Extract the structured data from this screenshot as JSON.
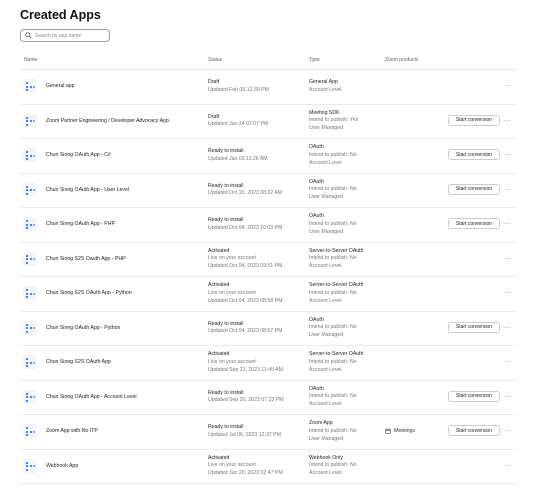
{
  "page": {
    "title": "Created Apps"
  },
  "search": {
    "placeholder": "Search by app name"
  },
  "table": {
    "headers": {
      "name": "Name",
      "status": "Status",
      "type": "Type",
      "products": "Zoom products"
    },
    "convert_label": "Start conversion",
    "more_label": "···",
    "rows": [
      {
        "name": "General app",
        "status": [
          "Draft",
          "Updated Feb 05 12:39 PM"
        ],
        "type": [
          "General App",
          "Account Level"
        ],
        "product": "",
        "convert": false
      },
      {
        "name": "Zoom Partner Engineering / Developer Advocacy App",
        "status": [
          "Draft",
          "Updated Jan 24 02:07 PM"
        ],
        "type": [
          "Meeting SDK",
          "Intend to publish: Yes",
          "User Managed"
        ],
        "product": "",
        "convert": true
      },
      {
        "name": "Chun Siong OAuth App - C#",
        "status": [
          "Ready to install",
          "Updated Jan 03 11:26 AM"
        ],
        "type": [
          "OAuth",
          "Intend to publish: No",
          "Account Level"
        ],
        "product": "",
        "convert": true
      },
      {
        "name": "Chun Siong OAuth App - User Level",
        "status": [
          "Ready to install",
          "Updated Oct 10, 2023 08:32 AM"
        ],
        "type": [
          "OAuth",
          "Intend to publish: No",
          "User Managed"
        ],
        "product": "",
        "convert": true
      },
      {
        "name": "Chun Siong OAuth App - PHP",
        "status": [
          "Ready to install",
          "Updated Oct 04, 2023 10:03 PM"
        ],
        "type": [
          "OAuth",
          "Intend to publish: No",
          "User Managed"
        ],
        "product": "",
        "convert": true
      },
      {
        "name": "Chun Siong S2S Oauth App - PHP",
        "status": [
          "Activated",
          "Live on your account",
          "Updated Oct 04, 2023 09:51 PM"
        ],
        "type": [
          "Server-to-Server OAuth",
          "Intend to publish: No",
          "Account Level"
        ],
        "product": "",
        "convert": false
      },
      {
        "name": "Chun Siong S2S OAuth App - Python",
        "status": [
          "Activated",
          "Live on your account",
          "Updated Oct 04, 2023 08:58 PM"
        ],
        "type": [
          "Server-to-Server OAuth",
          "Intend to publish: No",
          "Account Level"
        ],
        "product": "",
        "convert": false
      },
      {
        "name": "Chun Siong OAuth App - Python",
        "status": [
          "Ready to install",
          "Updated Oct 04, 2023 08:57 PM"
        ],
        "type": [
          "OAuth",
          "Intend to publish: No",
          "User Managed"
        ],
        "product": "",
        "convert": true
      },
      {
        "name": "Chun Siong S2S OAuth App",
        "status": [
          "Activated",
          "Live on your account",
          "Updated Sep 21, 2023 11:45 AM"
        ],
        "type": [
          "Server-to-Server OAuth",
          "Intend to publish: No",
          "Account Level"
        ],
        "product": "",
        "convert": false
      },
      {
        "name": "Chun Siong OAuth App - Account Level",
        "status": [
          "Ready to install",
          "Updated Sep 20, 2023 07:23 PM"
        ],
        "type": [
          "OAuth",
          "Intend to publish: No",
          "Account Level"
        ],
        "product": "",
        "convert": true
      },
      {
        "name": "Zoom App with No ITP",
        "status": [
          "Ready to install",
          "Updated Jul 06, 2023 12:37 PM"
        ],
        "type": [
          "Zoom App",
          "Intend to publish: No",
          "User Managed"
        ],
        "product": "Meetings",
        "convert": true
      },
      {
        "name": "Webhook App",
        "status": [
          "Activated",
          "Live on your account",
          "Updated Jun 20, 2023 02:47 PM"
        ],
        "type": [
          "Webhook Only",
          "Intend to publish: No",
          "Account Level"
        ],
        "product": "",
        "convert": false
      }
    ]
  }
}
